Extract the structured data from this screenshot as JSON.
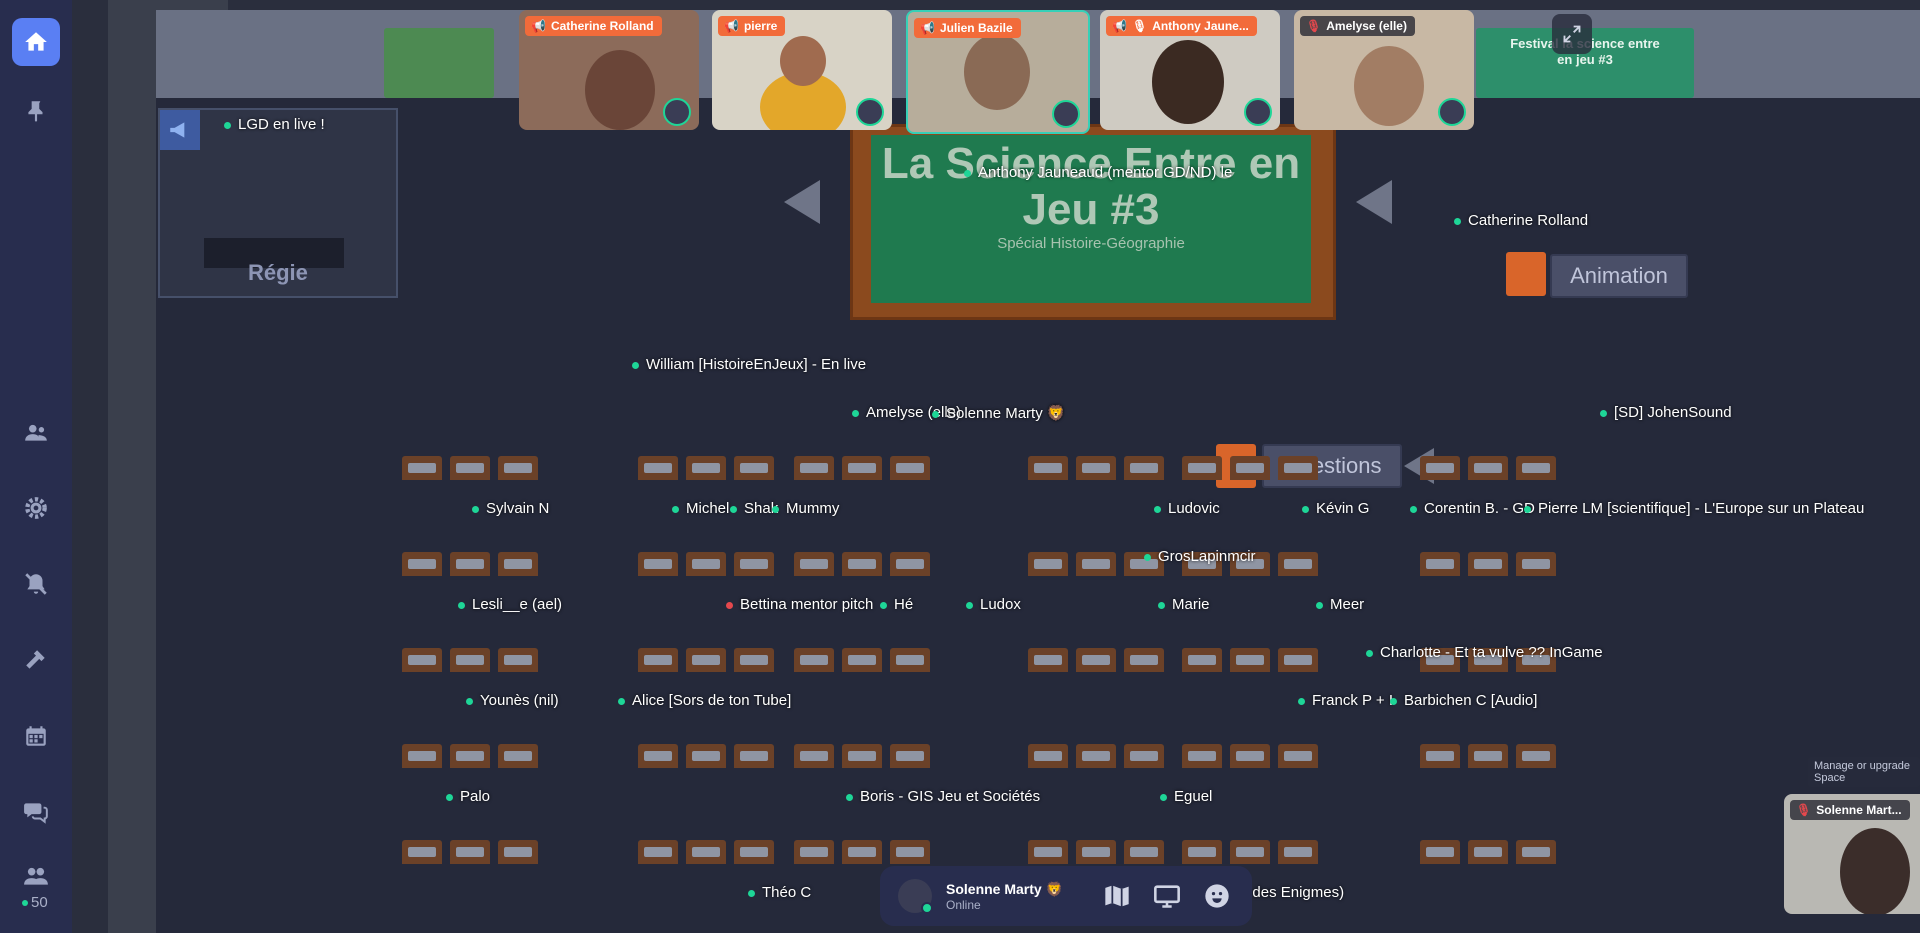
{
  "sidebar": {
    "items": [
      "home",
      "pin",
      "participants",
      "settings",
      "notifications-off",
      "build",
      "calendar",
      "chat"
    ],
    "online_count": "50"
  },
  "video_tiles": [
    {
      "name": "Catherine Rolland",
      "tag_style": "orange",
      "speaker": true,
      "muted": false
    },
    {
      "name": "pierre",
      "tag_style": "orange",
      "speaker": true,
      "muted": false
    },
    {
      "name": "Julien Bazile",
      "tag_style": "orange",
      "speaker": true,
      "muted": false
    },
    {
      "name": "Anthony Jaune...",
      "tag_style": "orange",
      "speaker": true,
      "muted": true
    },
    {
      "name": "Amelyse (elle)",
      "tag_style": "dark",
      "speaker": false,
      "muted": true
    }
  ],
  "map": {
    "stage_title": "La Science Entre en Jeu #3",
    "stage_subtitle": "Spécial Histoire-Géographie",
    "poster_festival": "Festival la science entre en jeu #3",
    "rooms": {
      "regie": "Régie",
      "animation": "Animation",
      "questions": "Questions"
    },
    "name_labels": [
      {
        "text": "LGD en live !",
        "status": "green"
      },
      {
        "text": "Anthony Jauneaud (mentor GD/ND) le",
        "status": "green"
      },
      {
        "text": "Catherine Rolland",
        "status": "green"
      },
      {
        "text": "William [HistoireEnJeux] - En live",
        "status": "green"
      },
      {
        "text": "Amelyse (elle)",
        "status": "green"
      },
      {
        "text": "Solenne Marty 🦁",
        "status": "green"
      },
      {
        "text": "[SD] JohenSound",
        "status": "green"
      },
      {
        "text": "Sylvain N",
        "status": "green"
      },
      {
        "text": "Michel",
        "status": "green"
      },
      {
        "text": "Shak",
        "status": "green"
      },
      {
        "text": "Mummy",
        "status": "green"
      },
      {
        "text": "Ludovic",
        "status": "green"
      },
      {
        "text": "Kévin G",
        "status": "green"
      },
      {
        "text": "Corentin B. - GD",
        "status": "green"
      },
      {
        "text": "Pierre LM [scientifique] - L'Europe sur un Plateau",
        "status": "green"
      },
      {
        "text": "GrosLapinmcir",
        "status": "green"
      },
      {
        "text": "Lesli__e (ael)",
        "status": "green"
      },
      {
        "text": "Bettina mentor pitch",
        "status": "red"
      },
      {
        "text": "Hé",
        "status": "green"
      },
      {
        "text": "Ludox",
        "status": "green"
      },
      {
        "text": "Marie",
        "status": "green"
      },
      {
        "text": "Meer",
        "status": "green"
      },
      {
        "text": "Charlotte - Et ta vulve ?? InGame",
        "status": "green"
      },
      {
        "text": "Younès (nil)",
        "status": "green"
      },
      {
        "text": "Alice [Sors de ton Tube]",
        "status": "green"
      },
      {
        "text": "Franck P + I",
        "status": "green"
      },
      {
        "text": "Barbichen C [Audio]",
        "status": "green"
      },
      {
        "text": "Palo",
        "status": "green"
      },
      {
        "text": "Boris - GIS Jeu et Sociétés",
        "status": "green"
      },
      {
        "text": "Eguel",
        "status": "green"
      },
      {
        "text": "Théo C",
        "status": "green"
      },
      {
        "text": "(Le Salon des Enigmes)",
        "status": "none"
      }
    ]
  },
  "self_view": {
    "name": "Solenne Mart...",
    "muted": true
  },
  "manage_link": "Manage or upgrade Space",
  "bottom_bar": {
    "name": "Solenne Marty 🦁",
    "status": "Online"
  },
  "colors": {
    "accent": "#5a7ff3",
    "online": "#1ed697",
    "speaker_tag": "#f26b3a",
    "sidebar": "#282d4e"
  }
}
